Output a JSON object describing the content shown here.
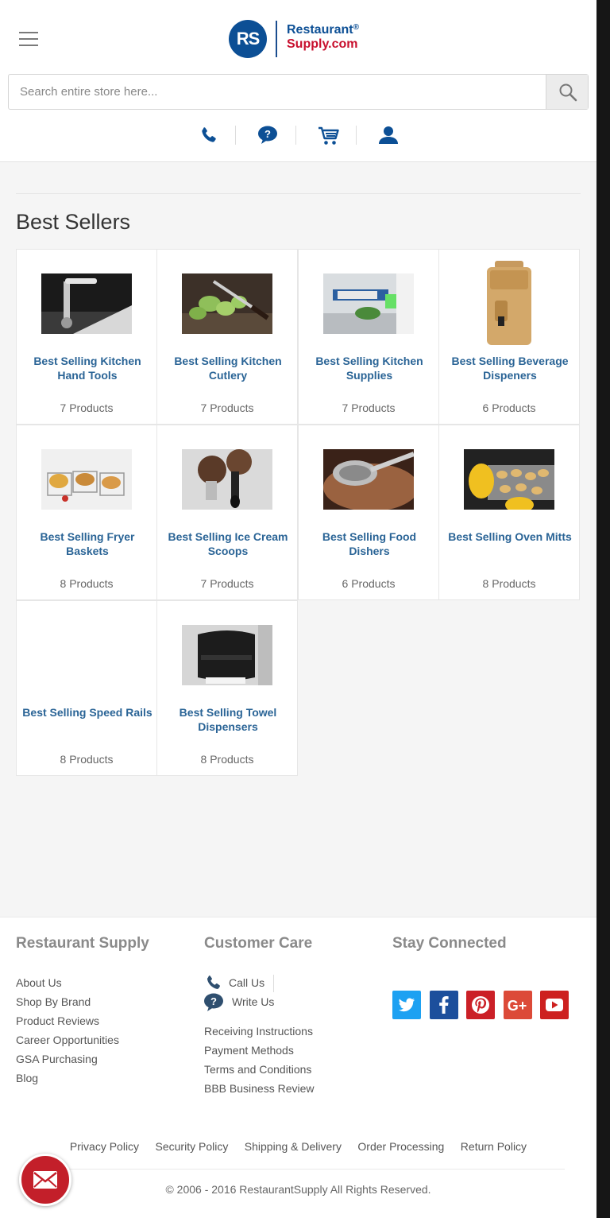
{
  "header": {
    "logo": {
      "mark": "RS",
      "line1": "Restaurant",
      "registered": "®",
      "line2": "Supply.com"
    },
    "search": {
      "placeholder": "Search entire store here..."
    },
    "quicknav": [
      "phone-icon",
      "help-icon",
      "cart-icon",
      "account-icon"
    ]
  },
  "main": {
    "title": "Best Sellers",
    "categories": [
      {
        "title": "Best Selling Kitchen Hand Tools",
        "count": "7 Products"
      },
      {
        "title": "Best Selling Kitchen Cutlery",
        "count": "7 Products"
      },
      {
        "title": "Best Selling Kitchen Supplies",
        "count": "7 Products"
      },
      {
        "title": "Best Selling Beverage Dispeners",
        "count": "6 Products"
      },
      {
        "title": "Best Selling Fryer Baskets",
        "count": "8 Products"
      },
      {
        "title": "Best Selling Ice Cream Scoops",
        "count": "7 Products"
      },
      {
        "title": "Best Selling Food Dishers",
        "count": "6 Products"
      },
      {
        "title": "Best Selling Oven Mitts",
        "count": "8 Products"
      },
      {
        "title": "Best Selling Speed Rails",
        "count": "8 Products"
      },
      {
        "title": "Best Selling Towel Dispensers",
        "count": "8 Products"
      }
    ]
  },
  "footer": {
    "col1": {
      "heading": "Restaurant Supply",
      "links": [
        "About Us",
        "Shop By Brand",
        "Product Reviews",
        "Career Opportunities",
        "GSA Purchasing",
        "Blog"
      ]
    },
    "col2": {
      "heading": "Customer Care",
      "call": "Call Us",
      "write": "Write Us",
      "links": [
        "Receiving Instructions",
        "Payment Methods",
        "Terms and Conditions",
        "BBB Business Review"
      ]
    },
    "col3": {
      "heading": "Stay Connected",
      "social": [
        {
          "name": "twitter-icon",
          "color": "#1da1f2"
        },
        {
          "name": "facebook-icon",
          "color": "#1c4f9c"
        },
        {
          "name": "pinterest-icon",
          "color": "#cb2027"
        },
        {
          "name": "google-plus-icon",
          "color": "#dc4a38"
        },
        {
          "name": "youtube-icon",
          "color": "#cd201f"
        }
      ]
    },
    "policies": [
      "Privacy Policy",
      "Security Policy",
      "Shipping & Delivery",
      "Order Processing",
      "Return Policy"
    ],
    "copyright": "© 2006 - 2016 RestaurantSupply All Rights Reserved."
  },
  "colors": {
    "brand_blue": "#0c4f95",
    "brand_red": "#c8102e",
    "link": "#2a6496",
    "mail_button": "#c31f2a"
  }
}
